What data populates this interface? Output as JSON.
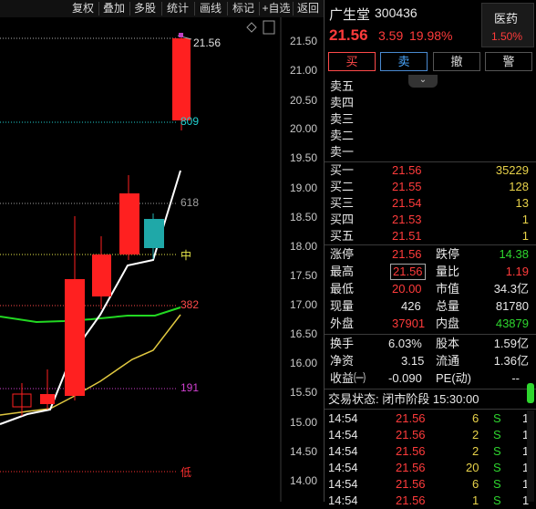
{
  "toolbar": {
    "items": [
      "复权",
      "叠加",
      "多股",
      "统计",
      "画线",
      "标记",
      "+自选",
      "返回"
    ]
  },
  "chart": {
    "y_ticks": [
      "21.50",
      "21.00",
      "20.50",
      "20.00",
      "19.50",
      "19.00",
      "18.50",
      "18.00",
      "17.50",
      "17.00",
      "16.50",
      "16.00",
      "15.50",
      "15.00",
      "14.50",
      "14.00"
    ],
    "high_label": "21.56",
    "fib_labels": [
      "809",
      "618",
      "中",
      "382",
      "191",
      "低"
    ],
    "colors": {
      "up": "#ff2020",
      "down": "#20b0b0",
      "fib_809": "#20d0d0",
      "fib_618": "#a0a0a0",
      "fib_mid": "#e8e84a",
      "fib_382": "#ff4a4a",
      "fib_191": "#d040d0",
      "fib_low": "#ff3030"
    }
  },
  "stock": {
    "name": "广生堂",
    "code": "300436",
    "price": "21.56",
    "change": "3.59",
    "change_pct": "19.98%",
    "sector": "医药",
    "sector_pct": "1.50%"
  },
  "trade_buttons": [
    "买",
    "卖",
    "撤",
    "警"
  ],
  "order_book": {
    "asks": [
      {
        "label": "卖五",
        "price": "",
        "vol": ""
      },
      {
        "label": "卖四",
        "price": "",
        "vol": ""
      },
      {
        "label": "卖三",
        "price": "",
        "vol": ""
      },
      {
        "label": "卖二",
        "price": "",
        "vol": ""
      },
      {
        "label": "卖一",
        "price": "",
        "vol": ""
      }
    ],
    "bids": [
      {
        "label": "买一",
        "price": "21.56",
        "vol": "35229"
      },
      {
        "label": "买二",
        "price": "21.55",
        "vol": "128"
      },
      {
        "label": "买三",
        "price": "21.54",
        "vol": "13"
      },
      {
        "label": "买四",
        "price": "21.53",
        "vol": "1"
      },
      {
        "label": "买五",
        "price": "21.51",
        "vol": "1"
      }
    ]
  },
  "quote": {
    "limit_up_label": "涨停",
    "limit_up": "21.56",
    "limit_down_label": "跌停",
    "limit_down": "14.38",
    "high_label": "最高",
    "high": "21.56",
    "vol_ratio_label": "量比",
    "vol_ratio": "1.19",
    "low_label": "最低",
    "low": "20.00",
    "mcap_label": "市值",
    "mcap": "34.3亿",
    "cur_vol_label": "现量",
    "cur_vol": "426",
    "total_vol_label": "总量",
    "total_vol": "81780",
    "outer_label": "外盘",
    "outer": "37901",
    "inner_label": "内盘",
    "inner": "43879",
    "turnover_label": "换手",
    "turnover": "6.03%",
    "equity_label": "股本",
    "equity": "1.59亿",
    "nav_label": "净资",
    "nav": "3.15",
    "float_label": "流通",
    "float": "1.36亿",
    "eps_label": "收益㈠",
    "eps": "-0.090",
    "pe_label": "PE(动)",
    "pe": "--"
  },
  "status": "交易状态: 闭市阶段 15:30:00",
  "ticks": [
    {
      "time": "14:54",
      "price": "21.56",
      "vol": "6",
      "side": "S",
      "n": "1"
    },
    {
      "time": "14:54",
      "price": "21.56",
      "vol": "2",
      "side": "S",
      "n": "1"
    },
    {
      "time": "14:54",
      "price": "21.56",
      "vol": "2",
      "side": "S",
      "n": "1"
    },
    {
      "time": "14:54",
      "price": "21.56",
      "vol": "20",
      "side": "S",
      "n": "1"
    },
    {
      "time": "14:54",
      "price": "21.56",
      "vol": "6",
      "side": "S",
      "n": "1"
    },
    {
      "time": "14:54",
      "price": "21.56",
      "vol": "1",
      "side": "S",
      "n": "1"
    }
  ]
}
